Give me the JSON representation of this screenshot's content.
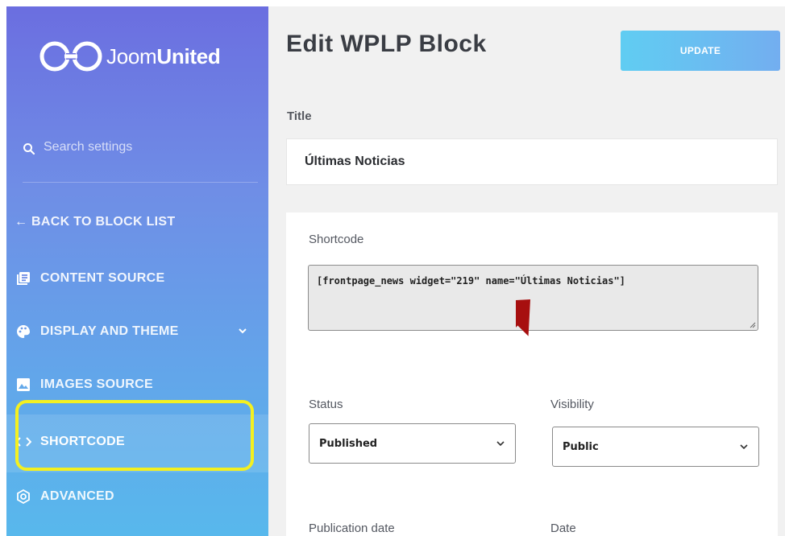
{
  "brand": {
    "name_light": "Joom",
    "name_bold": "United"
  },
  "search": {
    "placeholder": "Search settings"
  },
  "nav": {
    "back": "← BACK TO BLOCK LIST",
    "content_source": "CONTENT SOURCE",
    "display_theme": "DISPLAY AND THEME",
    "images_source": "IMAGES SOURCE",
    "shortcode": "SHORTCODE",
    "advanced": "ADVANCED"
  },
  "header": {
    "title": "Edit WPLP Block",
    "update_label": "UPDATE"
  },
  "form": {
    "title_label": "Title",
    "title_value": "Últimas Noticias",
    "shortcode_label": "Shortcode",
    "shortcode_value": "[frontpage_news widget=\"219\" name=\"Últimas Noticias\"]",
    "status_label": "Status",
    "status_value": "Published",
    "visibility_label": "Visibility",
    "visibility_value": "Public",
    "publication_date_label": "Publication date",
    "date_label": "Date"
  },
  "colors": {
    "highlight_box": "#f4f020",
    "annotation_arrow": "#a70f0f",
    "update_button": "#6bbef1"
  }
}
